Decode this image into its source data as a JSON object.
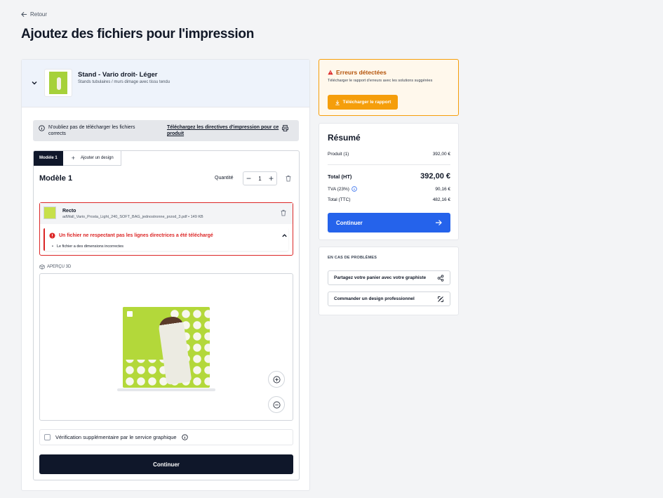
{
  "nav": {
    "back_label": "Retour"
  },
  "page": {
    "title": "Ajoutez des fichiers pour l'impression"
  },
  "product": {
    "name": "Stand - Vario droit- Léger",
    "subtitle": "Stands tubulaires / murs dimage avec tissu tendu"
  },
  "notice": {
    "text": "N'oubliez pas de télécharger les fichiers corrects",
    "link": "Téléchargez les directives d'impression pour ce produit"
  },
  "model": {
    "tabs": {
      "active": "Modèle 1",
      "add": "Ajouter un design"
    },
    "title": "Modèle 1",
    "quantity_label": "Quantité",
    "quantity": "1",
    "file": {
      "side": "Recto",
      "name": "adWall_Vario_Prosta_Light_240_SOFT_BAG_jednostronne_przod_3.pdf",
      "size": "149 KB",
      "meta": "adWall_Vario_Prosta_Light_240_SOFT_BAG_jednostronne_przod_3.pdf • 149 KB"
    },
    "error": {
      "title": "Un fichier ne respectant pas les lignes directrices a été téléchargé",
      "detail": "Le fichier a des dimensions incorrectes"
    },
    "preview_label": "APERÇU 3D",
    "verify_label": "Vérification supplémentaire par le service graphique",
    "continue_label": "Continuer"
  },
  "errors_card": {
    "title": "Erreurs détectées",
    "desc": "Télécharger le rapport d'erreurs avec les solutions suggérées",
    "button": "Télécharger le rapport"
  },
  "summary": {
    "title": "Résumé",
    "product_label": "Produit (1)",
    "product_value": "392,00 €",
    "total_ht_label": "Total (HT)",
    "total_ht_value": "392,00 €",
    "tva_label": "TVA (23%)",
    "tva_value": "90,16 €",
    "total_ttc_label": "Total (TTC)",
    "total_ttc_value": "482,16 €",
    "continue_label": "Continuer"
  },
  "help": {
    "title": "EN CAS DE PROBLÈMES",
    "share_label": "Partagez votre panier avec votre graphiste",
    "order_label": "Commander un design professionnel"
  },
  "colors": {
    "accent_blue": "#2563eb",
    "warning": "#f59e0b",
    "error": "#dc2626",
    "dark": "#0f172a",
    "product_green": "#b3d83a"
  }
}
